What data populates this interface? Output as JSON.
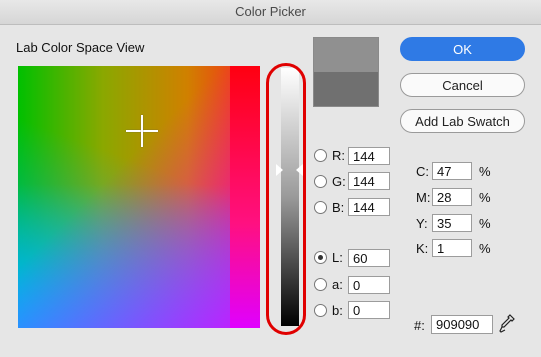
{
  "window": {
    "title": "Color Picker"
  },
  "lab_view": {
    "label": "Lab Color Space View"
  },
  "buttons": {
    "ok": "OK",
    "cancel": "Cancel",
    "add_lab_swatch": "Add Lab Swatch"
  },
  "swatch": {
    "new_color": "#909090",
    "old_color": "#707070"
  },
  "channels": {
    "R": {
      "label": "R:",
      "value": "144"
    },
    "G": {
      "label": "G:",
      "value": "144"
    },
    "B": {
      "label": "B:",
      "value": "144"
    },
    "L": {
      "label": "L:",
      "value": "60",
      "selected": true
    },
    "a": {
      "label": "a:",
      "value": "0"
    },
    "b": {
      "label": "b:",
      "value": "0"
    }
  },
  "cmyk": {
    "C": {
      "label": "C:",
      "value": "47",
      "unit": "%"
    },
    "M": {
      "label": "M:",
      "value": "28",
      "unit": "%"
    },
    "Y": {
      "label": "Y:",
      "value": "35",
      "unit": "%"
    },
    "K": {
      "label": "K:",
      "value": "1",
      "unit": "%"
    }
  },
  "hex": {
    "label": "#:",
    "value": "909090"
  },
  "accent": {
    "ok_button": "#2f7ae5",
    "highlight_ring": "#e00000"
  },
  "icons": {
    "eyedropper": "eyedropper-icon"
  }
}
